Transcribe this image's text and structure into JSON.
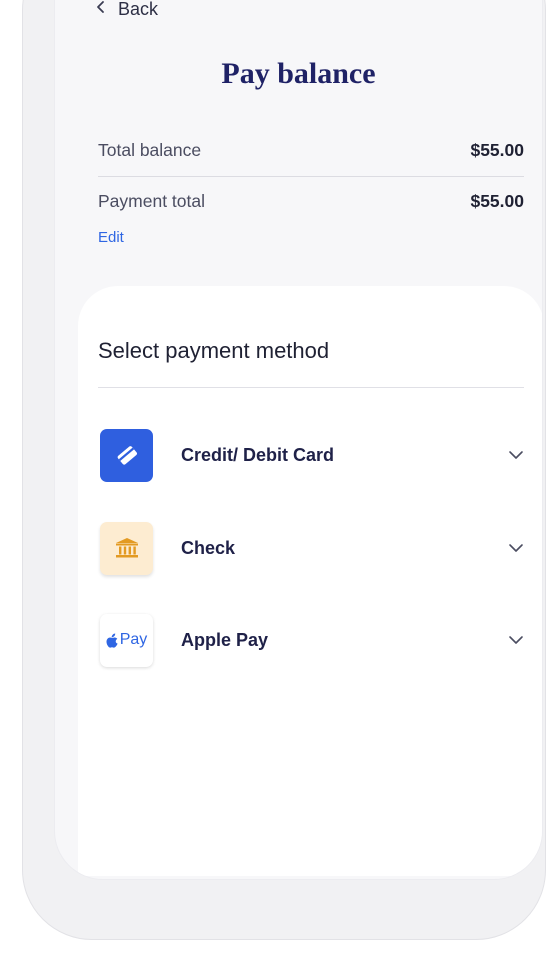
{
  "nav": {
    "back_label": "Back"
  },
  "page": {
    "title": "Pay balance"
  },
  "summary": {
    "total_balance_label": "Total balance",
    "total_balance_value": "$55.00",
    "payment_total_label": "Payment total",
    "payment_total_value": "$55.00",
    "edit_label": "Edit"
  },
  "payment_methods": {
    "heading": "Select payment method",
    "items": [
      {
        "label": "Credit/ Debit Card",
        "icon": "credit-card-icon"
      },
      {
        "label": "Check",
        "icon": "bank-icon"
      },
      {
        "label": "Apple Pay",
        "icon": "apple-pay-icon",
        "icon_text": "Pay"
      }
    ]
  },
  "colors": {
    "title": "#1f2266",
    "accent_blue": "#2f66e3",
    "card_tile": "#2f5fdf",
    "check_tile": "#fdecd1",
    "check_icon": "#e39a22"
  }
}
